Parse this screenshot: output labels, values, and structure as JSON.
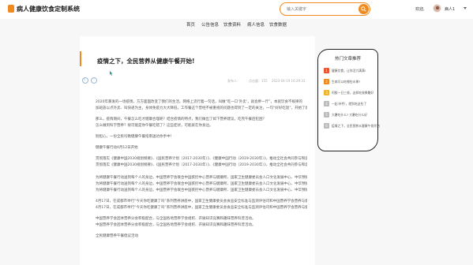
{
  "header": {
    "site_title": "病人健康饮食定制系统",
    "search_placeholder": "输入关键字",
    "welcome": "欢迎,",
    "username": "病人1",
    "colors": {
      "accent": "#f08a1e"
    }
  },
  "nav": {
    "items": [
      "首页",
      "公告信息",
      "饮食资料",
      "病人信息",
      "饮食数据"
    ]
  },
  "article": {
    "title": "疫情之下，全民营养从健康午餐开始!",
    "likes": "0",
    "favorites": "0",
    "publisher": "发布人：",
    "clicks": "点击量：155",
    "time": "2023-04-19 16:29:33",
    "paragraphs": [
      "2020年暴发的一场疫情，方方面面改变了我们的生活。网络上流行着一句话，叫做“吃一口‘外卖’，就会胖一斤”，本就饮食不规律的",
      "加班族以点外卖、叫快递为主，身体免疫力大大降低，工作餐这个曾经不被重视的问题也得到了一定的关注，一句“好好吃饭”，开始了新的关注点。",
      "那么，疫情期间，午餐怎么吃才健康合理呢？结合疫情的特点，我们做出了如下营养建议，吃完午餐后犯困？",
      "怎么做到科学营养？很可能是你午餐吃错了？这些症状，可能就在你身边。",
      "别担心，一份全民均衡健康午餐指南送达你手中！",
      "健康午餐行动4月12日开始",
      "贯彻落实《健康中国2030规划纲要》、《国民营养计划（2017-2030年）》、《健康中国行动（2019-2030年）》，推动全社会共同参与和促进营养健康科普教育活动，倡导全民营养健康理念。",
      "为将健康午餐行动送到每个人的身边，中国营养学会联合中国疾控中心营养与健康所、国家卫生健康委员会人口文化发展中心、中华预防医学会、中国营养学会等单位，中国营养学会团体营养分会、中国营养学会公共营养分会、中国营养学会营养与保健食品分会，与中国营养学会等一起组织开展健康午餐行动。",
      "4月17日，在成都市举行“今天你吃健康了吗”系列营养讲座中，国家卫生健康委员会食品安全标准与监测评估司和中国营养学会营养与健康科学专家，针对健康午餐主题进行宣讲。",
      "中国营养学会团体营养分会积极配合，与全国各地营养学会组织、开展知识竞赛和趣味营养科普活动。",
      "全民健康营养午餐倡议活动"
    ]
  },
  "sidebar": {
    "title": "热门文章推荐",
    "items": [
      {
        "rank": "1",
        "text": "健康饮食，让你活力满满!",
        "color": "#e8552f"
      },
      {
        "rank": "2",
        "text": "生病可以吃哪些水果?",
        "color": "#f08a1e"
      },
      {
        "rank": "3",
        "text": "阿胶一日三餐，这样吃效果最好",
        "color": "#f0b428"
      },
      {
        "rank": "4",
        "text": "一起‘补钙’，就别吃这些了",
        "color": "#bbbbbb"
      },
      {
        "rank": "5",
        "text": "大暑吃什么? 大暑吃什么好",
        "color": "#bbbbbb"
      },
      {
        "rank": "6",
        "text": "疫情之下，全民营养从健康午餐开始",
        "color": "#bbbbbb"
      }
    ]
  }
}
